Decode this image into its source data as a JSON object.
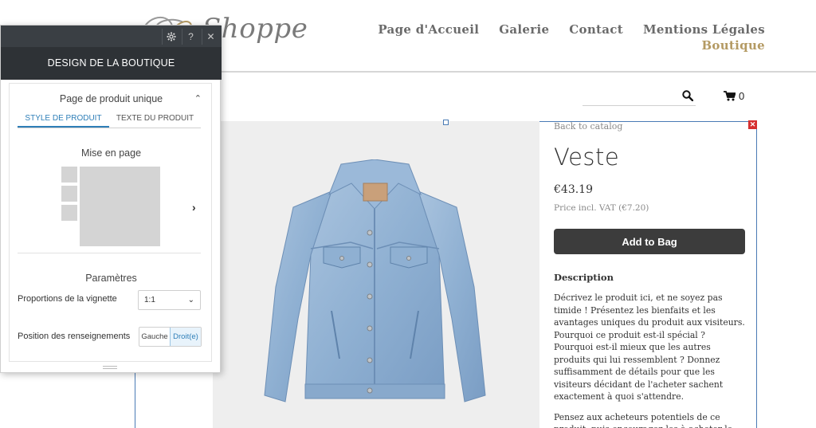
{
  "site": {
    "logo_text": "Shoppe",
    "nav": {
      "home": "Page d'Accueil",
      "gallery": "Galerie",
      "contact": "Contact",
      "legal": "Mentions Légales",
      "shop": "Boutique"
    }
  },
  "toolbar": {
    "cart_count": "0"
  },
  "product": {
    "back_link": "Back to catalog",
    "title": "Veste",
    "price": "€43.19",
    "vat": "Price incl. VAT (€7.20)",
    "add_button": "Add to Bag",
    "description_heading": "Description",
    "description_p1": "Décrivez le produit ici, et ne soyez pas timide ! Présentez les bienfaits et les avantages uniques du produit aux visiteurs. Pourquoi ce produit est-il spécial ? Pourquoi est-il mieux que les autres produits qui lui ressemblent ? Donnez suffisamment de détails pour que les visiteurs décidant de l'acheter sachent exactement à quoi s'attendre.",
    "description_p2": "Pensez aux acheteurs potentiels de ce produit, puis encouragez-les à acheter le produit en"
  },
  "panel": {
    "title": "DESIGN DE LA BOUTIQUE",
    "section": "Page de produit unique",
    "tabs": [
      "STYLE DE PRODUIT",
      "TEXTE DU PRODUIT"
    ],
    "layout_label": "Mise en page",
    "params_label": "Paramètres",
    "thumb_ratio_label": "Proportions de la vignette",
    "thumb_ratio_value": "1:1",
    "info_position_label": "Position des renseignements",
    "info_position_options": [
      "Gauche",
      "Droit(e)"
    ],
    "info_position_selected": "Droit(e)"
  },
  "colors": {
    "accent_gold": "#b49a63",
    "panel_dark": "#2e3236",
    "tab_active": "#2f7fb8",
    "button_dark": "#3c3c3c"
  },
  "icons": {
    "gear": "gear-icon",
    "help": "help-icon",
    "close": "close-icon",
    "search": "search-icon",
    "cart": "cart-icon"
  }
}
